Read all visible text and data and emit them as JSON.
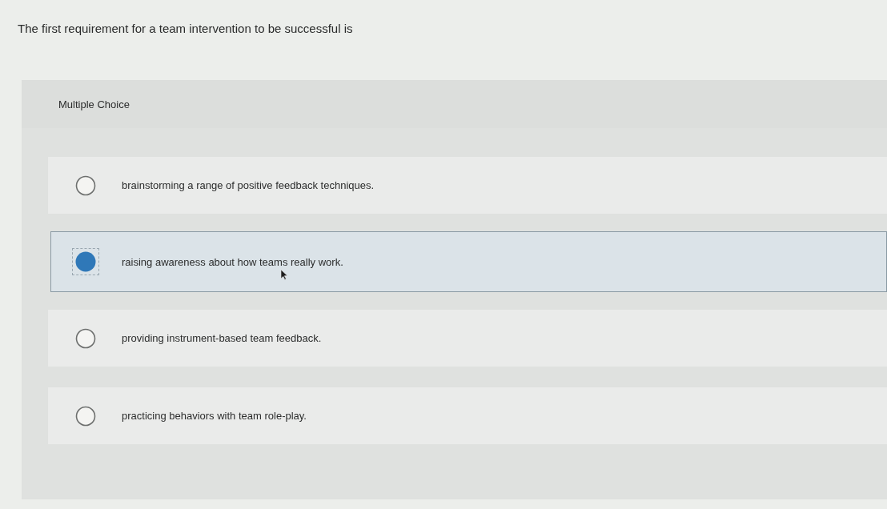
{
  "question": "The first requirement for a team intervention to be successful is",
  "answer_panel": {
    "question_type": "Multiple Choice",
    "options": [
      {
        "text": "brainstorming a range of positive feedback techniques.",
        "selected": false
      },
      {
        "text": "raising awareness about how teams really work.",
        "selected": true
      },
      {
        "text": "providing instrument-based team feedback.",
        "selected": false
      },
      {
        "text": "practicing behaviors with team role-play.",
        "selected": false
      }
    ]
  }
}
